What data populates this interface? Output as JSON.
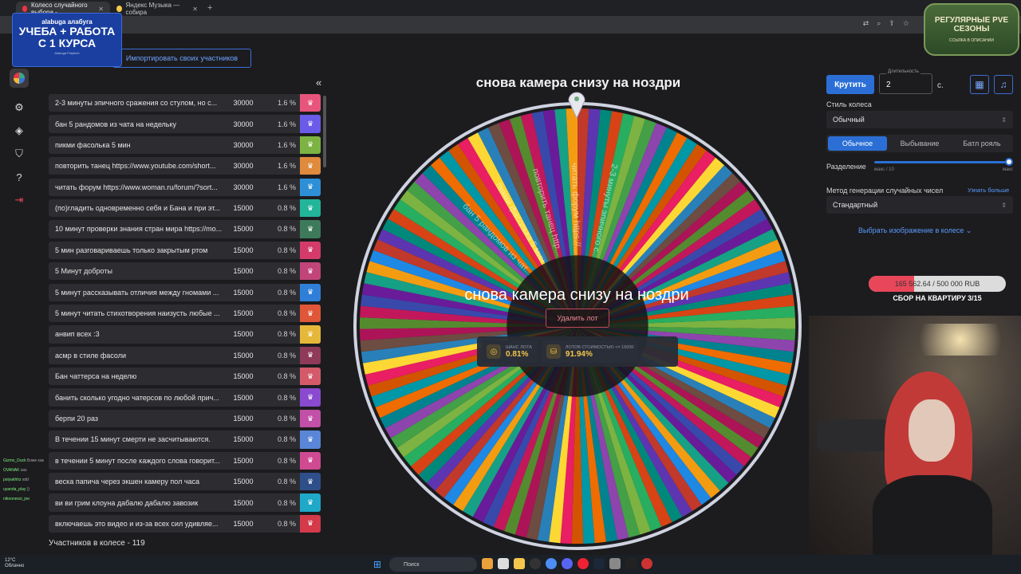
{
  "browser": {
    "tabs": [
      {
        "label": "Колесо случайного выбора -",
        "active": true
      },
      {
        "label": "Яндекс Музыка — собира",
        "active": false
      }
    ]
  },
  "promo": {
    "brand": "alabuga алабуга",
    "line1": "УЧЕБА + РАБОТА",
    "line2": "С 1 КУРСА",
    "fine": "Alabuga Polytech"
  },
  "season_badge": {
    "title": "РЕГУЛЯРНЫЕ PVE СЕЗОНЫ",
    "subtitle": "ССЫЛКА В ОПИСАНИИ"
  },
  "import_label": "Импортировать своих участников",
  "nav_icons": [
    "wheel-icon",
    "gear-icon",
    "layers-icon",
    "shield-icon",
    "help-icon",
    "logout-icon"
  ],
  "participants": [
    {
      "name": "2-3 минуты эпичного сражения со стулом, но с...",
      "amount": "30000",
      "pct": "1.6 %",
      "color": "#e8557a"
    },
    {
      "name": "бан 5 рандомов из чата на недельку",
      "amount": "30000",
      "pct": "1.6 %",
      "color": "#6a5be8"
    },
    {
      "name": "пикми фасолька 5 мин",
      "amount": "30000",
      "pct": "1.6 %",
      "color": "#7cb342"
    },
    {
      "name": "повторить танец https://www.youtube.com/short...",
      "amount": "30000",
      "pct": "1.6 %",
      "color": "#e08a3c"
    },
    {
      "name": "читать форум https://www.woman.ru/forum/?sort...",
      "amount": "30000",
      "pct": "1.6 %",
      "color": "#2e8fd6"
    },
    {
      "name": "(по)гладить одновременно себя и Бана и при эт...",
      "amount": "15000",
      "pct": "0.8 %",
      "color": "#22b59a"
    },
    {
      "name": "10 минут проверки знания стран мира https://mo...",
      "amount": "15000",
      "pct": "0.8 %",
      "color": "#3d7a5a"
    },
    {
      "name": "5 мин разговариваешь только закрытым ртом",
      "amount": "15000",
      "pct": "0.8 %",
      "color": "#d43b6a"
    },
    {
      "name": "5 Минут доброты",
      "amount": "15000",
      "pct": "0.8 %",
      "color": "#c1447a"
    },
    {
      "name": "5 минут рассказывать отличия между гномами ...",
      "amount": "15000",
      "pct": "0.8 %",
      "color": "#2f7fd8"
    },
    {
      "name": "5 минут читать стихотворения наизусть любые ...",
      "amount": "15000",
      "pct": "0.8 %",
      "color": "#e05638"
    },
    {
      "name": "анвип всех :3",
      "amount": "15000",
      "pct": "0.8 %",
      "color": "#e5b83a"
    },
    {
      "name": "асмр в стиле фасоли",
      "amount": "15000",
      "pct": "0.8 %",
      "color": "#8f3a58"
    },
    {
      "name": "Бан чаттерса на неделю",
      "amount": "15000",
      "pct": "0.8 %",
      "color": "#d45a6a"
    },
    {
      "name": "банить сколько угодно чатерсов по любой прич...",
      "amount": "15000",
      "pct": "0.8 %",
      "color": "#8a4ad0"
    },
    {
      "name": "берпи 20 раз",
      "amount": "15000",
      "pct": "0.8 %",
      "color": "#c24fa8"
    },
    {
      "name": "В течении 15 минут смерти не засчитываются.",
      "amount": "15000",
      "pct": "0.8 %",
      "color": "#5a86d8"
    },
    {
      "name": "в течении 5 минут после каждого слова говорит...",
      "amount": "15000",
      "pct": "0.8 %",
      "color": "#d04a92"
    },
    {
      "name": "веска папича через экшен камеру пол часа",
      "amount": "15000",
      "pct": "0.8 %",
      "color": "#2f4f8a"
    },
    {
      "name": "ви ви грим клоуна дабалю дабалю завозик",
      "amount": "15000",
      "pct": "0.8 %",
      "color": "#1fa8c8"
    },
    {
      "name": "включаешь это видео и из-за всех сил удивляе...",
      "amount": "15000",
      "pct": "0.8 %",
      "color": "#d43a4a"
    }
  ],
  "participants_count": "Участников в колесе - 119",
  "chat_lines": [
    {
      "user": "Gizmo_Duck",
      "text": "Боже как"
    },
    {
      "user": "OVANAK",
      "text": "хах"
    },
    {
      "user": "polyakhhz",
      "text": "xdd"
    },
    {
      "user": "uyanda_play",
      "text": "))"
    },
    {
      "user": "nikoonessi_joe",
      "text": ""
    }
  ],
  "wheel": {
    "title": "снова камера снизу на ноздри",
    "winner": "снова камера снизу на ноздри",
    "delete_label": "Удалить лот",
    "chance_label": "ШАНС ЛОТА",
    "chance_value": "0.81%",
    "cost_label": "ЛОТОВ СТОИМОСТЬЮ <= 15000",
    "cost_value": "91.94%",
    "segment_count": 119,
    "segment_labels": [
      "2-3 минуты эпичного с...",
      "читать форум https://...",
      "повторить танец http...",
      "пикми фасолька 5 мин",
      "бан 5 рандомов из чат..."
    ]
  },
  "controls": {
    "spin_label": "Крутить",
    "duration_label": "Длительность",
    "duration_value": "2",
    "duration_unit": "с.",
    "style_label": "Стиль колеса",
    "style_value": "Обычный",
    "modes": [
      "Обычное",
      "Выбывание",
      "Батл рояль"
    ],
    "split_label": "Разделение",
    "split_min": "макс / 10",
    "split_max": "макс",
    "split_fraction": 1.0,
    "rng_label": "Метод генерации случайных чисел",
    "rng_link": "Узнать больше",
    "rng_value": "Стандартный",
    "image_link": "Выбрать изображение в колесе"
  },
  "goal": {
    "text": "165 562.64 / 500 000 RUB",
    "progress": 0.331,
    "caption": "СБОР НА КВАРТИРУ 3/15"
  },
  "taskbar": {
    "temp": "12°C",
    "weather": "Облачно",
    "search": "Поиск"
  }
}
